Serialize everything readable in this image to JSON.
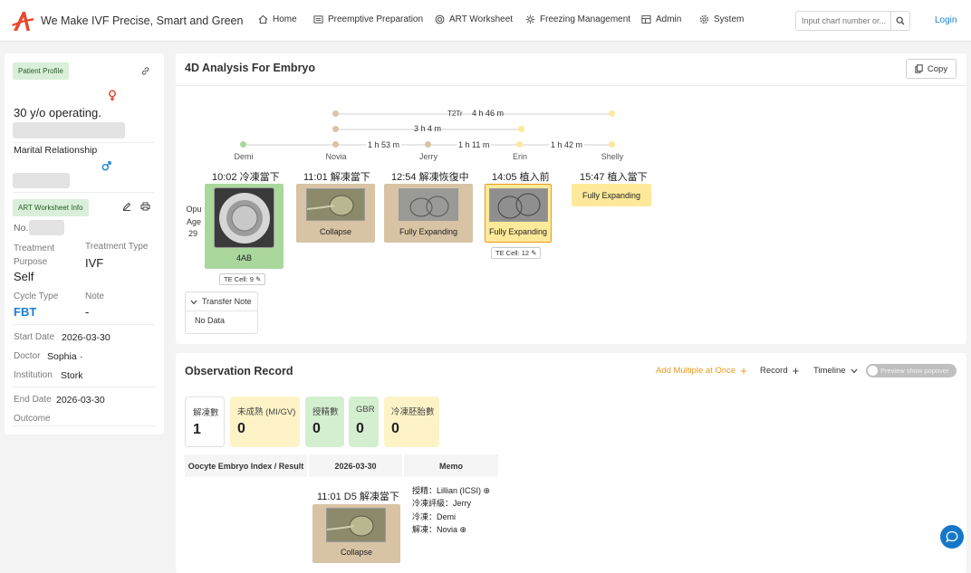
{
  "brand": {
    "tagline": "We Make IVF Precise, Smart and Green",
    "accent": "#e8472b"
  },
  "nav": [
    {
      "label": "Home",
      "icon": "home-icon"
    },
    {
      "label": "Preemptive Preparation",
      "icon": "list-icon"
    },
    {
      "label": "ART Worksheet",
      "icon": "target-icon"
    },
    {
      "label": "Freezing Management",
      "icon": "snow-gear-icon"
    },
    {
      "label": "Admin",
      "icon": "grid-icon"
    },
    {
      "label": "System",
      "icon": "gear-icon"
    }
  ],
  "search": {
    "placeholder": "Input chart number or..."
  },
  "login_label": "Login",
  "profile": {
    "tag": "Patient Profile",
    "age_text": "30 y/o operating.",
    "marital_label": "Marital Relationship",
    "art_tag": "ART Worksheet Info",
    "no_label": "No.",
    "treatment_purpose_label": "Treatment Purpose",
    "treatment_purpose": "Self",
    "treatment_type_label": "Treatment Type",
    "treatment_type": "IVF",
    "cycle_type_label": "Cycle Type",
    "cycle_type": "FBT",
    "note_label": "Note",
    "note": "-",
    "start_date_label": "Start Date",
    "start_date": "2026-03-30",
    "doctor_label": "Doctor",
    "doctor": "Sophia",
    "doctor_suffix": "·",
    "institution_label": "Institution",
    "institution": "Stork",
    "end_date_label": "End Date",
    "end_date": "2026-03-30",
    "outcome_label": "Outcome"
  },
  "analysis": {
    "title": "4D Analysis For Embryo",
    "copy_label": "Copy",
    "timeline": {
      "t2tr_label": "T2Tr",
      "t2tr_duration": "4 h 46 m",
      "span_duration": "3 h 4 m",
      "seg_durations": [
        "1 h 53 m",
        "1 h 11 m",
        "1 h 42 m"
      ],
      "names": [
        "Demi",
        "Novia",
        "Jerry",
        "Erin",
        "Shelly"
      ]
    },
    "opu_label": "Opu Age",
    "opu_age": "29",
    "events": [
      {
        "time": "10:02 冷凍當下",
        "caption": "4AB",
        "te": "TE Cell: 9"
      },
      {
        "time": "11:01 解凍當下",
        "caption": "Collapse"
      },
      {
        "time": "12:54 解凍恢復中",
        "caption": "Fully Expanding"
      },
      {
        "time": "14:05 植入前",
        "caption": "Fully Expanding",
        "te": "TE Cell: 12"
      },
      {
        "time": "15:47 植入當下",
        "caption": "Fully Expanding"
      }
    ],
    "transfer_note_label": "Transfer Note",
    "transfer_note_value": "No Data"
  },
  "observation": {
    "title": "Observation Record",
    "add_multiple": "Add Multiple at Once",
    "record": "Record",
    "timeline": "Timeline",
    "preview": "Preview show popover",
    "stats": [
      {
        "label": "解凍數",
        "value": "1"
      },
      {
        "label": "未成熟 (MI/GV)",
        "value": "0"
      },
      {
        "label": "授精數",
        "value": "0"
      },
      {
        "label": "GBR",
        "value": "0"
      },
      {
        "label": "冷凍胚胎數",
        "value": "0"
      }
    ],
    "table_headers": [
      "Oocyte Embryo Index / Result",
      "2026-03-30",
      "Memo"
    ],
    "entry_time": "11:01 D5 解凍當下",
    "entry_caption": "Collapse",
    "memo": [
      "授精：Lillian (ICSI)",
      "冷凍評級：Jerry",
      "冷凍：Demi",
      "解凍：Novia"
    ]
  },
  "colors": {
    "green": "#a9d79c",
    "tan": "#d8c3a5",
    "yellow": "#fde99a",
    "orange": "#e89a1c",
    "blue": "#1a7fd6"
  }
}
